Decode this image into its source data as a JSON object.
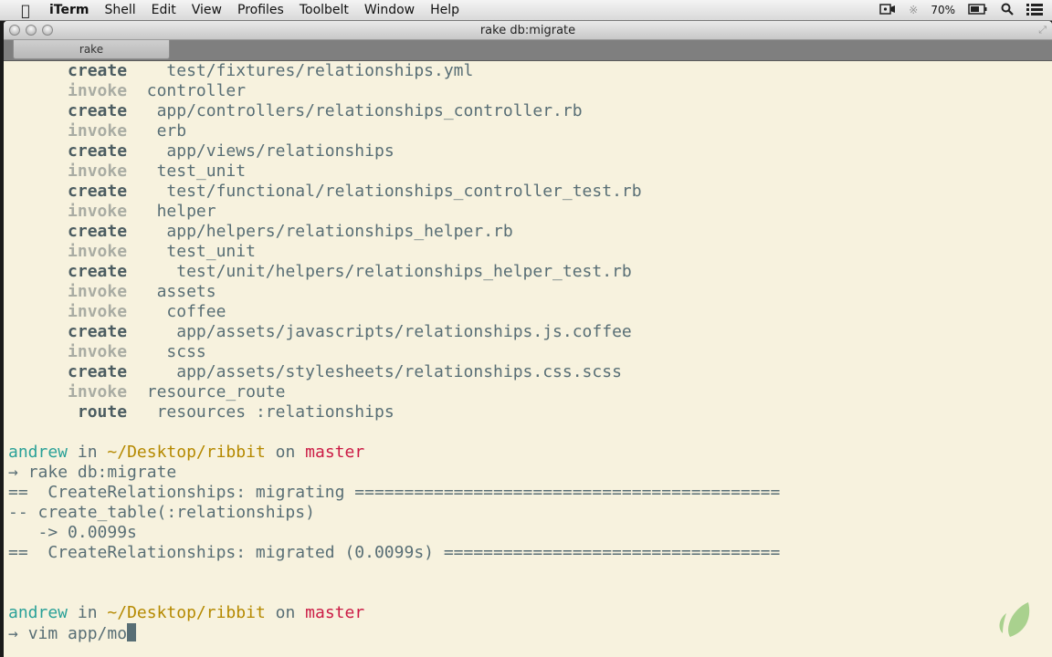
{
  "menubar": {
    "app": "iTerm",
    "items": [
      "Shell",
      "Edit",
      "View",
      "Profiles",
      "Toolbelt",
      "Window",
      "Help"
    ],
    "battery": "70%",
    "icons": [
      "apple-icon",
      "camera-icon",
      "bluetooth-icon",
      "battery-icon",
      "spotlight-icon",
      "notification-list-icon"
    ]
  },
  "window": {
    "title": "rake db:migrate",
    "tab": "rake"
  },
  "terminal": {
    "generator_lines": [
      {
        "action": "create",
        "indent": "    ",
        "text": "test/fixtures/relationships.yml"
      },
      {
        "action": "invoke",
        "indent": "  ",
        "text": "controller"
      },
      {
        "action": "create",
        "indent": "   ",
        "text": "app/controllers/relationships_controller.rb"
      },
      {
        "action": "invoke",
        "indent": "   ",
        "text": "erb"
      },
      {
        "action": "create",
        "indent": "    ",
        "text": "app/views/relationships"
      },
      {
        "action": "invoke",
        "indent": "   ",
        "text": "test_unit"
      },
      {
        "action": "create",
        "indent": "    ",
        "text": "test/functional/relationships_controller_test.rb"
      },
      {
        "action": "invoke",
        "indent": "   ",
        "text": "helper"
      },
      {
        "action": "create",
        "indent": "    ",
        "text": "app/helpers/relationships_helper.rb"
      },
      {
        "action": "invoke",
        "indent": "    ",
        "text": "test_unit"
      },
      {
        "action": "create",
        "indent": "     ",
        "text": "test/unit/helpers/relationships_helper_test.rb"
      },
      {
        "action": "invoke",
        "indent": "   ",
        "text": "assets"
      },
      {
        "action": "invoke",
        "indent": "    ",
        "text": "coffee"
      },
      {
        "action": "create",
        "indent": "     ",
        "text": "app/assets/javascripts/relationships.js.coffee"
      },
      {
        "action": "invoke",
        "indent": "    ",
        "text": "scss"
      },
      {
        "action": "create",
        "indent": "     ",
        "text": "app/assets/stylesheets/relationships.css.scss"
      },
      {
        "action": "invoke",
        "indent": "  ",
        "text": "resource_route"
      },
      {
        "action": " route",
        "indent": "   ",
        "text": "resources :relationships"
      }
    ],
    "prompt": {
      "user": "andrew",
      "in": "in",
      "path": "~/Desktop/ribbit",
      "on": "on",
      "branch": "master",
      "arrow": "→"
    },
    "command1": "rake db:migrate",
    "migration_lines": [
      "==  CreateRelationships: migrating ===========================================",
      "-- create_table(:relationships)",
      "   -> 0.0099s",
      "==  CreateRelationships: migrated (0.0099s) =================================="
    ],
    "command2": "vim app/mo"
  }
}
